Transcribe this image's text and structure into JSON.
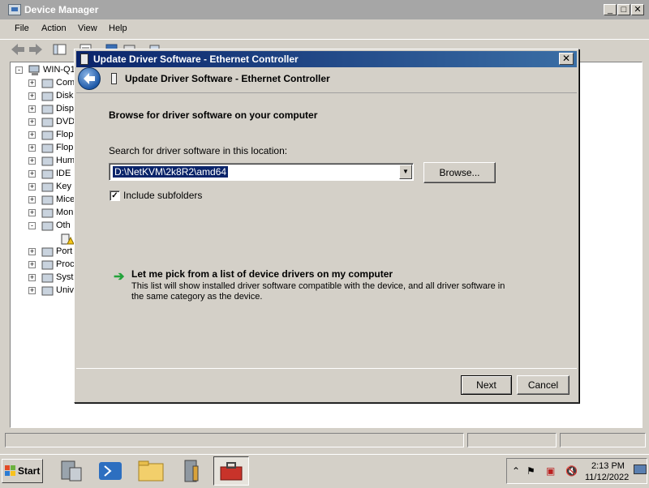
{
  "device_manager": {
    "title": "Device Manager",
    "menu": [
      "File",
      "Action",
      "View",
      "Help"
    ],
    "tree_root": "WIN-Q1",
    "tree_items": [
      {
        "label": "Com",
        "expander": "+"
      },
      {
        "label": "Disk",
        "expander": "+"
      },
      {
        "label": "Disp",
        "expander": "+"
      },
      {
        "label": "DVD",
        "expander": "+"
      },
      {
        "label": "Flop",
        "expander": "+"
      },
      {
        "label": "Flop",
        "expander": "+"
      },
      {
        "label": "Hum",
        "expander": "+"
      },
      {
        "label": "IDE",
        "expander": "+"
      },
      {
        "label": "Key",
        "expander": "+"
      },
      {
        "label": "Mice",
        "expander": "+"
      },
      {
        "label": "Mon",
        "expander": "+"
      },
      {
        "label": "Oth",
        "expander": "-"
      },
      {
        "label": "",
        "expander": ""
      },
      {
        "label": "Port",
        "expander": "+"
      },
      {
        "label": "Proc",
        "expander": "+"
      },
      {
        "label": "Syst",
        "expander": "+"
      },
      {
        "label": "Univ",
        "expander": "+"
      }
    ]
  },
  "dialog": {
    "window_title": "Update Driver Software - Ethernet Controller",
    "header_title": "Update Driver Software - Ethernet Controller",
    "section_heading": "Browse for driver software on your computer",
    "search_label": "Search for driver software in this location:",
    "path_value": "D:\\NetKVM\\2k8R2\\amd64",
    "browse_label": "Browse...",
    "include_subfolders_label": "Include subfolders",
    "include_subfolders_checked": true,
    "pick_title": "Let me pick from a list of device drivers on my computer",
    "pick_description": "This list will show installed driver software compatible with the device, and all driver software in the same category as the device.",
    "next_label": "Next",
    "cancel_label": "Cancel"
  },
  "taskbar": {
    "start_label": "Start",
    "pinned_icons": [
      "server-manager-icon",
      "powershell-icon",
      "explorer-folder-icon",
      "server-tools-icon",
      "toolbox-icon"
    ],
    "tray_icons": [
      "show-hidden-icons",
      "action-center-flag-icon",
      "network-error-icon",
      "volume-muted-icon"
    ],
    "clock_time": "2:13 PM",
    "clock_date": "11/12/2022"
  },
  "colors": {
    "accent_blue": "#1f5aa8",
    "arrow_green": "#22a23a",
    "selection": "#0a246a"
  }
}
